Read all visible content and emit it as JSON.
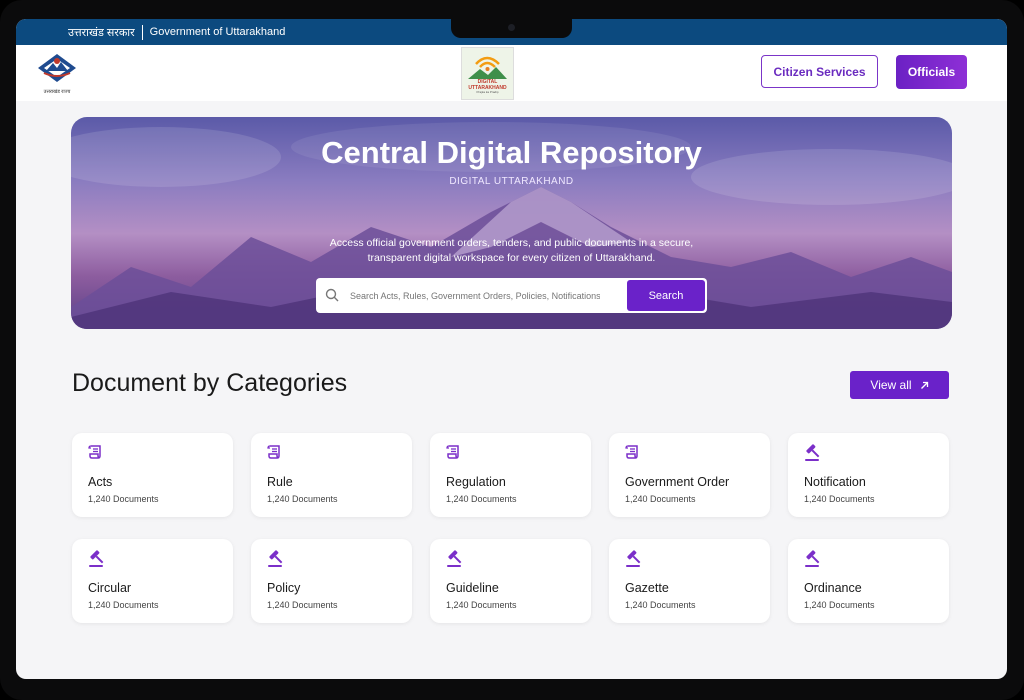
{
  "topbar": {
    "hindi_label": "उत्तराखंड सरकार",
    "english_label": "Government of Uttarakhand"
  },
  "header": {
    "logo_caption": "उत्तराखंड राज्य",
    "center_logo_lines": [
      "DIGITAL",
      "UTTARAKHAND"
    ],
    "center_logo_tagline": "Prajka ka Pradip",
    "citizen_services_label": "Citizen Services",
    "officials_label": "Officials"
  },
  "hero": {
    "title": "Central Digital Repository",
    "subtitle": "DIGITAL UTTARAKHAND",
    "description": "Access official government orders, tenders, and public documents in a secure, transparent digital workspace for every citizen of Uttarakhand.",
    "search_placeholder": "Search Acts, Rules, Government Orders, Policies, Notifications...",
    "search_button": "Search"
  },
  "categories": {
    "title": "Document by Categories",
    "view_all_label": "View all",
    "items": [
      {
        "name": "Acts",
        "count": "1,240 Documents",
        "icon": "scroll-icon"
      },
      {
        "name": "Rule",
        "count": "1,240 Documents",
        "icon": "scroll-icon"
      },
      {
        "name": "Regulation",
        "count": "1,240 Documents",
        "icon": "scroll-icon"
      },
      {
        "name": "Government Order",
        "count": "1,240 Documents",
        "icon": "scroll-icon"
      },
      {
        "name": "Notification",
        "count": "1,240 Documents",
        "icon": "gavel-icon"
      },
      {
        "name": "Circular",
        "count": "1,240 Documents",
        "icon": "gavel-icon"
      },
      {
        "name": "Policy",
        "count": "1,240 Documents",
        "icon": "gavel-icon"
      },
      {
        "name": "Guideline",
        "count": "1,240 Documents",
        "icon": "gavel-icon"
      },
      {
        "name": "Gazette",
        "count": "1,240 Documents",
        "icon": "gavel-icon"
      },
      {
        "name": "Ordinance",
        "count": "1,240 Documents",
        "icon": "gavel-icon"
      }
    ]
  },
  "colors": {
    "accent": "#6a22c9",
    "topbar": "#0c4a7f",
    "background": "#f5f5f7"
  }
}
